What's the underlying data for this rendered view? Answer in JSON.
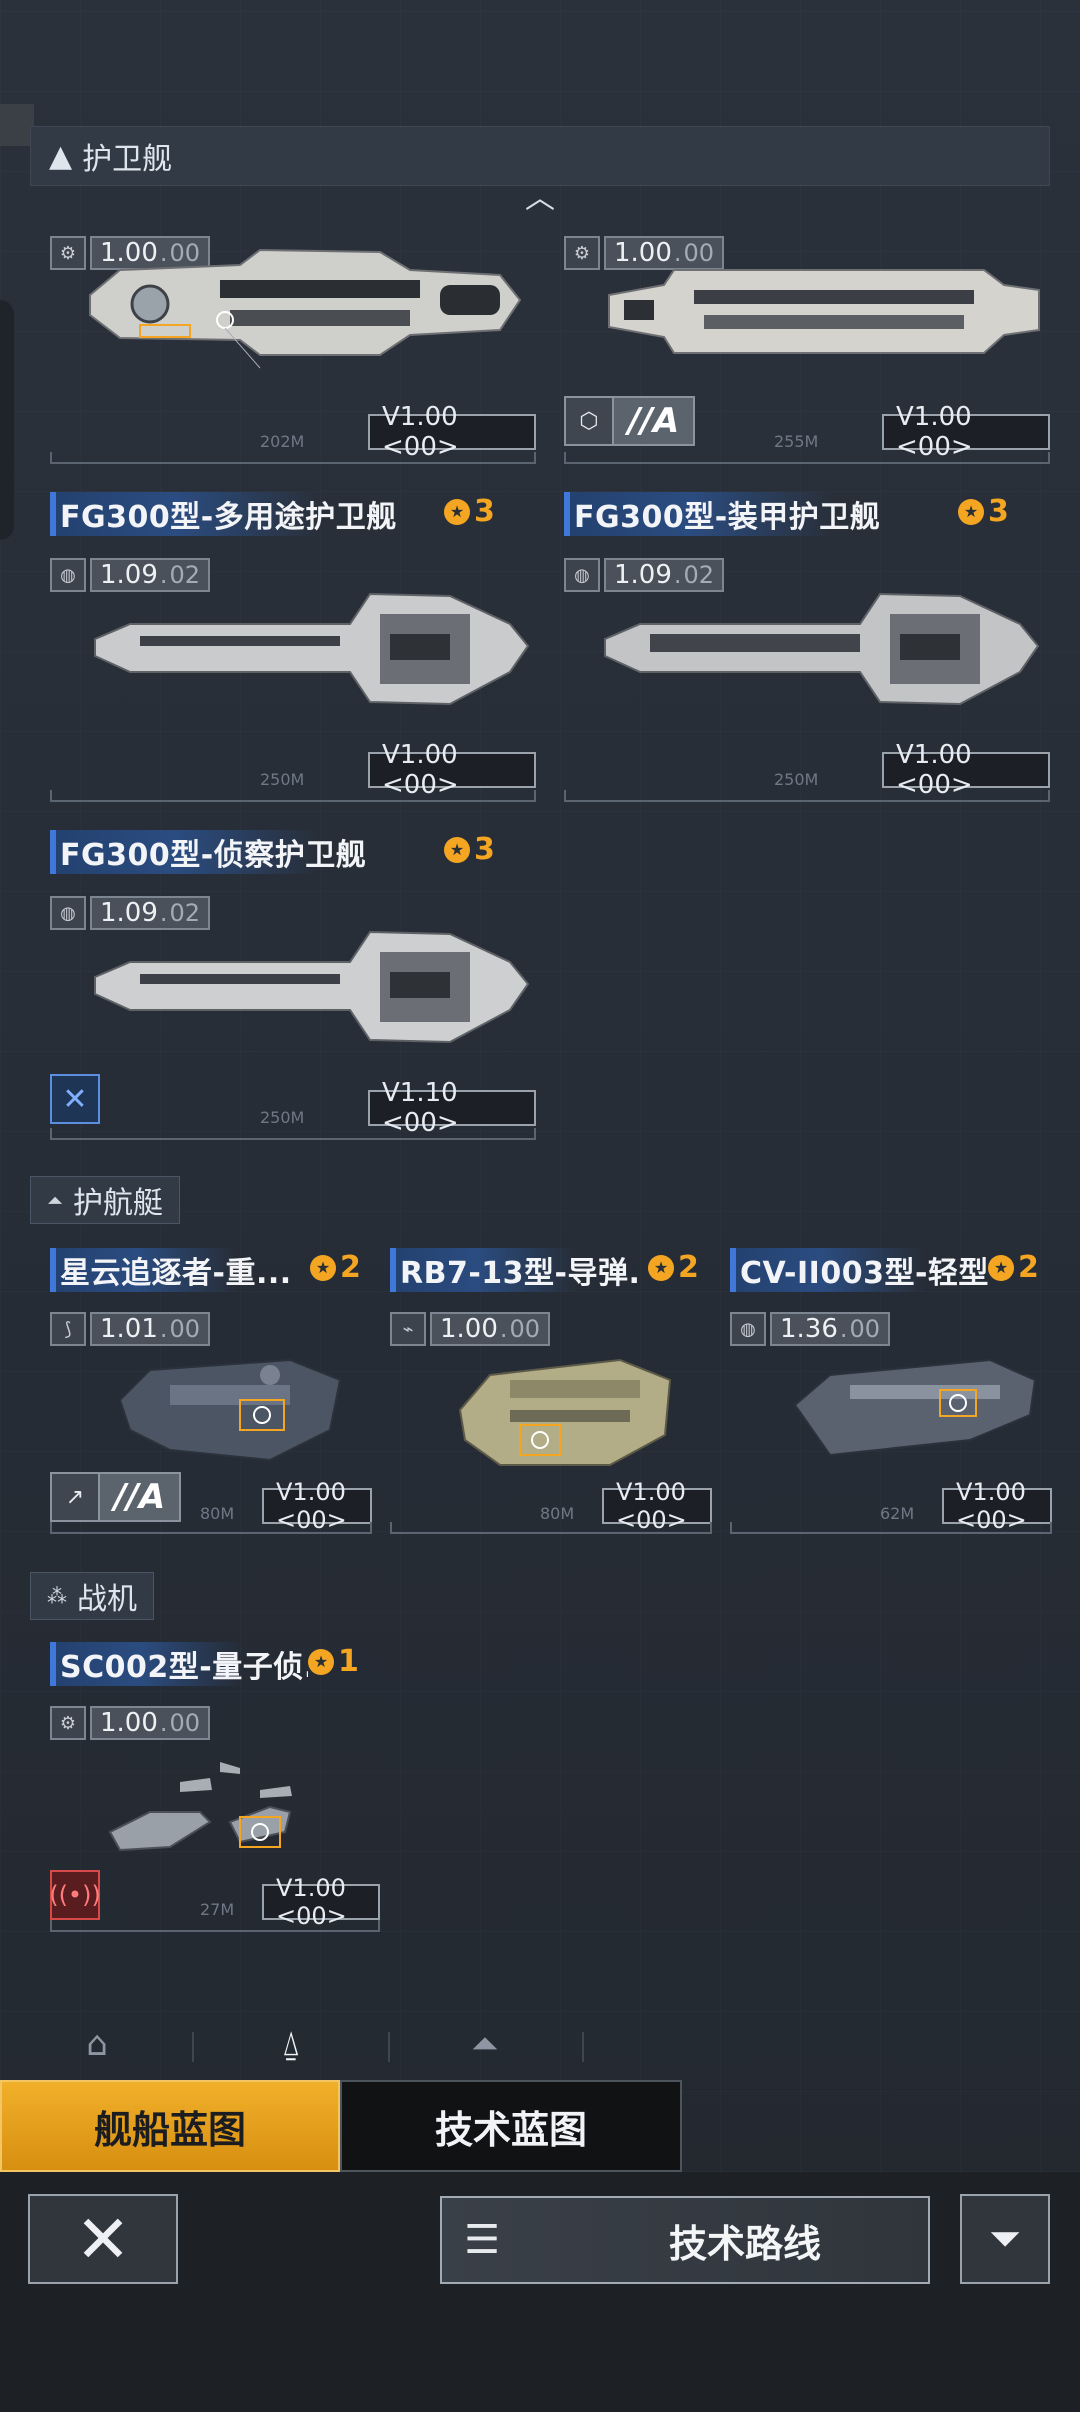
{
  "sections": {
    "frigate": "护卫舰",
    "corvette": "护航艇",
    "fighter": "战机"
  },
  "cards": [
    {
      "title": "",
      "stars": "",
      "ver_main": "1.00",
      "ver_sub": "00",
      "vtag": "V1.00 <00>",
      "scale": "202M",
      "rank": "//A",
      "ship": "carrier"
    },
    {
      "title": "",
      "stars": "",
      "ver_main": "1.00",
      "ver_sub": "00",
      "vtag": "V1.00 <00>",
      "scale": "255M",
      "rank": "//A",
      "ship": "carrier2"
    },
    {
      "title": "FG300型-多用途护卫舰",
      "stars": "3",
      "ver_main": "1.09",
      "ver_sub": "02",
      "vtag": "V1.00 <00>",
      "scale": "250M"
    },
    {
      "title": "FG300型-装甲护卫舰",
      "stars": "3",
      "ver_main": "1.09",
      "ver_sub": "02",
      "vtag": "V1.00 <00>",
      "scale": "250M"
    },
    {
      "title": "FG300型-侦察护卫舰",
      "stars": "3",
      "ver_main": "1.09",
      "ver_sub": "02",
      "vtag": "V1.10 <00>",
      "scale": "250M"
    },
    {
      "title": "星云追逐者-重...",
      "stars": "2",
      "ver_main": "1.01",
      "ver_sub": "00",
      "vtag": "V1.00 <00>",
      "scale": "80M",
      "rank": "//A"
    },
    {
      "title": "RB7-13型-导弹...",
      "stars": "2",
      "ver_main": "1.00",
      "ver_sub": "00",
      "vtag": "V1.00 <00>",
      "scale": "80M"
    },
    {
      "title": "CV-II003型-轻型...",
      "stars": "2",
      "ver_main": "1.36",
      "ver_sub": "00",
      "vtag": "V1.00 <00>",
      "scale": "62M"
    },
    {
      "title": "SC002型-量子侦...",
      "stars": "1",
      "ver_main": "1.00",
      "ver_sub": "00",
      "vtag": "V1.00 <00>",
      "scale": "27M"
    }
  ],
  "tabs": {
    "ship_blueprint": "舰船蓝图",
    "tech_blueprint": "技术蓝图"
  },
  "footer": {
    "tech_route": "技术路线"
  },
  "colors": {
    "accent": "#f4a623",
    "title_bar": "#2b4c80",
    "background": "#272d36"
  }
}
